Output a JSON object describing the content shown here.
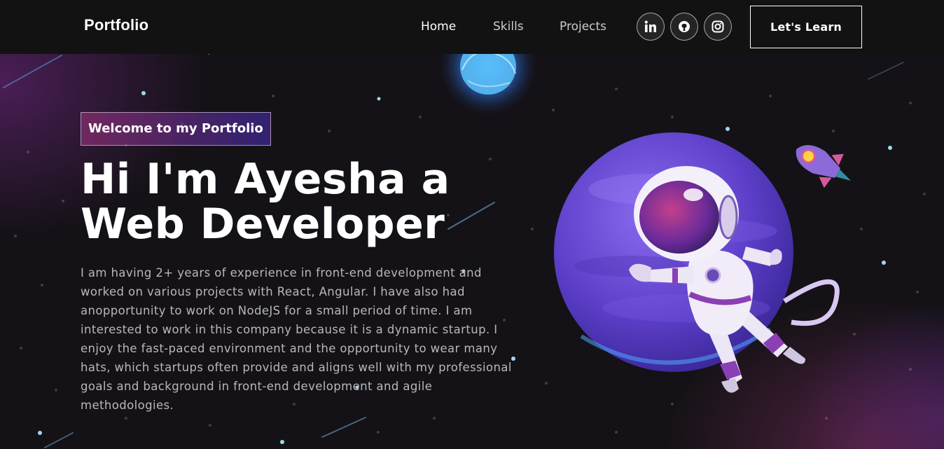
{
  "navbar": {
    "brand": "Portfolio",
    "links": [
      {
        "label": "Home"
      },
      {
        "label": "Skills"
      },
      {
        "label": "Projects"
      }
    ],
    "social_icons": [
      "linkedin-icon",
      "github-icon",
      "instagram-icon"
    ],
    "cta_label": "Let's Learn"
  },
  "hero": {
    "tagline": "Welcome to my Portfolio",
    "headline_line1": "Hi I'm Ayesha a",
    "headline_line2": "Web Developer",
    "bio": "I am having 2+ years of experience in front-end development and worked on various projects with React, Angular. I have also had anopportunity to work on NodeJS for a small period of time. I am interested to work in this company because it is a dynamic startup. I enjoy the fast-paced environment and the opportunity to wear many hats, which startups often provide and aligns well with my professional goals and background in front-end development and agile methodologies."
  },
  "illustration": {
    "items": [
      "astronaut",
      "planet",
      "rocket",
      "moon"
    ]
  },
  "colors": {
    "background": "#121212",
    "tagline_gradient_start": "#AA367C",
    "tagline_gradient_end": "#4A2FBD",
    "planet": "#6A45D6",
    "text_muted": "#B8B8B8"
  }
}
